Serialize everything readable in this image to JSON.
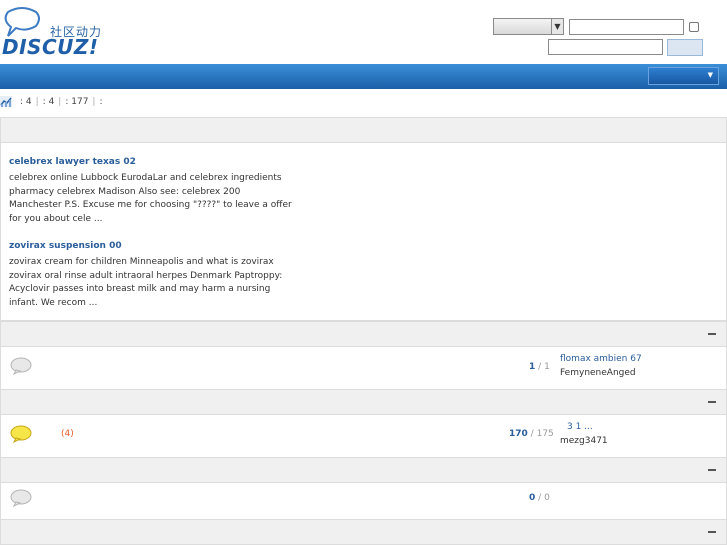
{
  "header": {
    "logo_tag": "社区动力",
    "logo_word": "DISCUZ!",
    "select_arrow": "▼"
  },
  "stats": {
    "item1": ": 4",
    "item2": ": 4",
    "item3": ": 177",
    "item4": ":"
  },
  "announcements": [
    {
      "title": "celebrex lawyer texas 02",
      "text": "celebrex online Lubbock EurodaLar and celebrex ingredients pharmacy celebrex Madison Also see: celebrex 200 Manchester P.S. Excuse me for choosing \"????\" to leave a offer for you about cele ..."
    },
    {
      "title": "zovirax suspension 00",
      "text": "zovirax cream for children Minneapolis and what is zovirax zovirax oral rinse adult intraoral herpes Denmark Paptroppy: Acyclovir passes into breast milk and may harm a nursing infant. We recom ..."
    }
  ],
  "forums": [
    {
      "new_count": "",
      "threads": "1",
      "posts": "1",
      "last_title": "flomax ambien 67",
      "last_user": "FemyneneAnged",
      "bubble_color": "#e8e8e8"
    },
    {
      "new_count": "(4)",
      "threads": "170",
      "posts": "175",
      "last_title": "3          1 ...",
      "last_user": "mezg3471",
      "bubble_color": "#f7e64a"
    },
    {
      "new_count": "",
      "threads": "0",
      "posts": "0",
      "last_title": "",
      "last_user": "",
      "bubble_color": "#e8e8e8"
    }
  ],
  "separator": "/",
  "colors": {
    "nav_blue": "#1f6cbf",
    "link_blue": "#2a5d9a",
    "new_count": "#e25c28"
  }
}
